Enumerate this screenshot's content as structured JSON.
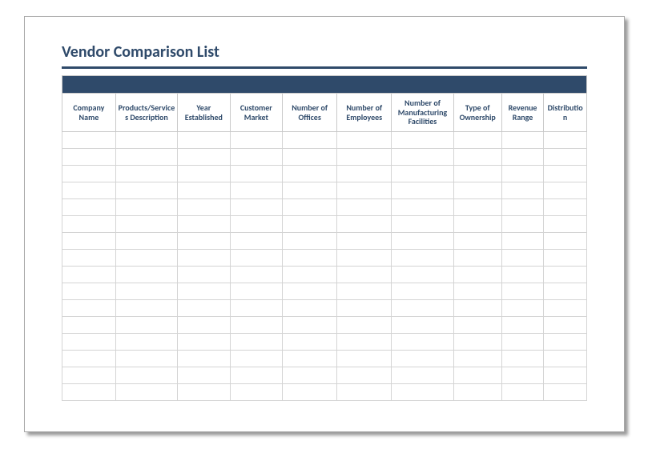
{
  "title": "Vendor Comparison List",
  "columns": [
    "Company Name",
    "Products/Services Description",
    "Year Established",
    "Customer Market",
    "Number of Offices",
    "Number of Employees",
    "Number of Manufacturing Facilities",
    "Type of Ownership",
    "Revenue Range",
    "Distribution"
  ],
  "rows": [
    [
      "",
      "",
      "",
      "",
      "",
      "",
      "",
      "",
      "",
      ""
    ],
    [
      "",
      "",
      "",
      "",
      "",
      "",
      "",
      "",
      "",
      ""
    ],
    [
      "",
      "",
      "",
      "",
      "",
      "",
      "",
      "",
      "",
      ""
    ],
    [
      "",
      "",
      "",
      "",
      "",
      "",
      "",
      "",
      "",
      ""
    ],
    [
      "",
      "",
      "",
      "",
      "",
      "",
      "",
      "",
      "",
      ""
    ],
    [
      "",
      "",
      "",
      "",
      "",
      "",
      "",
      "",
      "",
      ""
    ],
    [
      "",
      "",
      "",
      "",
      "",
      "",
      "",
      "",
      "",
      ""
    ],
    [
      "",
      "",
      "",
      "",
      "",
      "",
      "",
      "",
      "",
      ""
    ],
    [
      "",
      "",
      "",
      "",
      "",
      "",
      "",
      "",
      "",
      ""
    ],
    [
      "",
      "",
      "",
      "",
      "",
      "",
      "",
      "",
      "",
      ""
    ],
    [
      "",
      "",
      "",
      "",
      "",
      "",
      "",
      "",
      "",
      ""
    ],
    [
      "",
      "",
      "",
      "",
      "",
      "",
      "",
      "",
      "",
      ""
    ],
    [
      "",
      "",
      "",
      "",
      "",
      "",
      "",
      "",
      "",
      ""
    ],
    [
      "",
      "",
      "",
      "",
      "",
      "",
      "",
      "",
      "",
      ""
    ],
    [
      "",
      "",
      "",
      "",
      "",
      "",
      "",
      "",
      "",
      ""
    ],
    [
      "",
      "",
      "",
      "",
      "",
      "",
      "",
      "",
      "",
      ""
    ]
  ]
}
